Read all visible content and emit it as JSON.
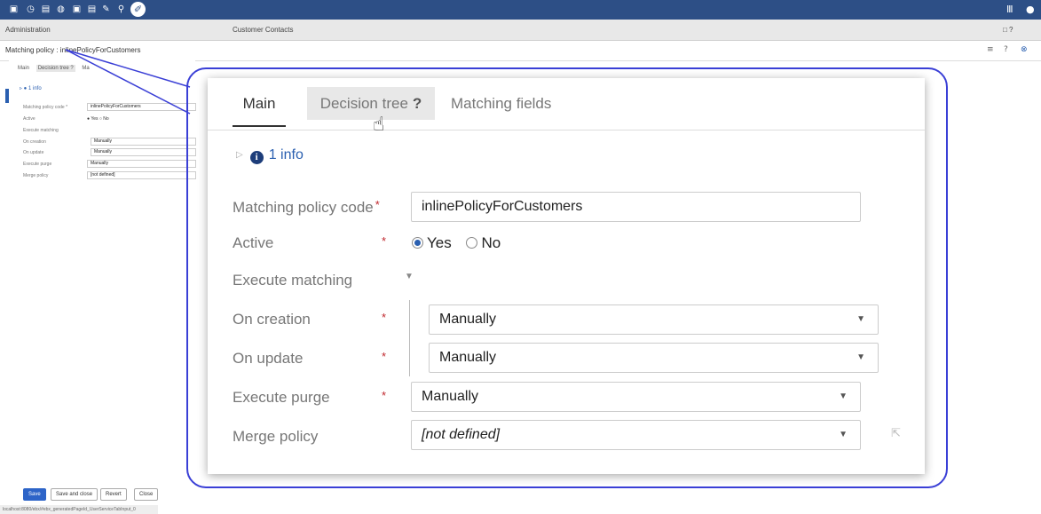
{
  "toolbar": {
    "icons": [
      "doc-icon",
      "clock-icon",
      "doc-icon",
      "link-icon",
      "doc-icon",
      "doc-icon",
      "pin-icon",
      "search-icon",
      "tools-icon"
    ],
    "right_icons": [
      "grid-icon",
      "user-icon"
    ]
  },
  "module_bar": {
    "left": "Administration",
    "center": "Customer Contacts",
    "right": "□ ?"
  },
  "page": {
    "title": "Matching policy : inlinePolicyForCustomers",
    "actions": [
      "≡",
      "?",
      "⊗"
    ]
  },
  "background_form": {
    "tabs": [
      "Main",
      "Decision tree ?",
      "Ma"
    ],
    "info": "1 info",
    "rows": [
      {
        "label": "Matching policy code *",
        "value": "inlinePolicyForCustomers"
      },
      {
        "label": "Active",
        "value": "● Yes ○ No"
      },
      {
        "label": "Execute matching",
        "value": ""
      },
      {
        "label": "On creation",
        "value": "Manually"
      },
      {
        "label": "On update",
        "value": "Manually"
      },
      {
        "label": "Execute purge",
        "value": "Manually"
      },
      {
        "label": "Merge policy",
        "value": "[not defined]"
      }
    ]
  },
  "footer": {
    "buttons": [
      "Save",
      "Save and close",
      "Revert",
      "Close"
    ]
  },
  "status_url": "localhost:8080/ebx/#ebx_generatedPageId_UserServiceTabInput_0",
  "zoom": {
    "tabs": {
      "main": "Main",
      "decision_tree": "Decision tree",
      "decision_tree_help": "?",
      "matching_fields": "Matching fields"
    },
    "info": "1 info",
    "form": {
      "matching_policy_code": {
        "label": "Matching policy code",
        "value": "inlinePolicyForCustomers"
      },
      "active": {
        "label": "Active",
        "yes": "Yes",
        "no": "No",
        "selected": "Yes"
      },
      "execute_matching": {
        "label": "Execute matching"
      },
      "on_creation": {
        "label": "On creation",
        "value": "Manually"
      },
      "on_update": {
        "label": "On update",
        "value": "Manually"
      },
      "execute_purge": {
        "label": "Execute purge",
        "value": "Manually"
      },
      "merge_policy": {
        "label": "Merge policy",
        "value": "[not defined]"
      }
    },
    "required_marker": "*"
  },
  "colors": {
    "topbar": "#2d4f86",
    "accent": "#2a5fb0",
    "callout": "#3a3fd6",
    "required": "#c0272d"
  }
}
